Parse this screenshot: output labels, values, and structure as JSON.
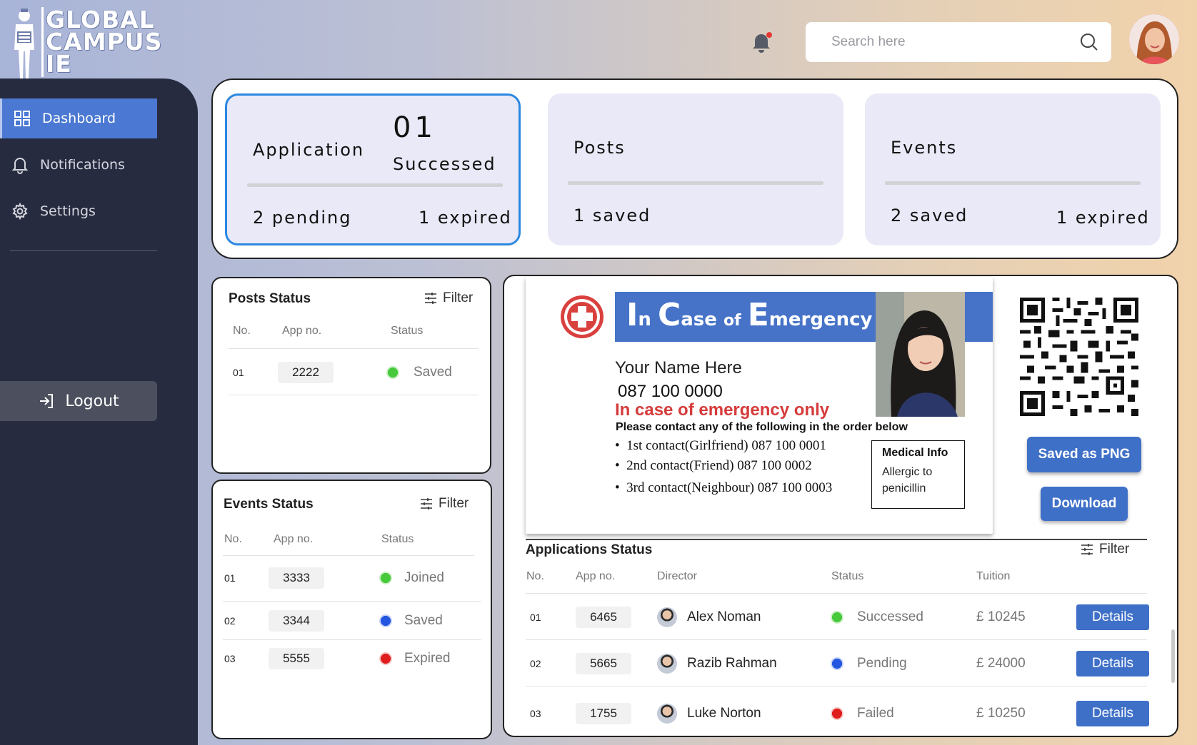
{
  "brand": {
    "logo_lines": [
      "GLOBAL",
      "CAMPUS",
      "IE"
    ]
  },
  "sidebar": {
    "items": [
      {
        "label": "Dashboard",
        "icon": "grid-icon",
        "active": true
      },
      {
        "label": "Notifications",
        "icon": "bell-icon",
        "active": false
      },
      {
        "label": "Settings",
        "icon": "gear-icon",
        "active": false
      }
    ],
    "logout_label": "Logout"
  },
  "header": {
    "search_placeholder": "Search here",
    "notification_badge": true
  },
  "summary": {
    "application": {
      "label": "Application",
      "count": "01",
      "count_label": "Successed",
      "left_note": "2 pending",
      "right_note": "1 expired"
    },
    "posts": {
      "label": "Posts",
      "left_note": "1 saved"
    },
    "events": {
      "label": "Events",
      "left_note": "2 saved",
      "right_note": "1 expired"
    }
  },
  "posts_status": {
    "title": "Posts Status",
    "filter_label": "Filter",
    "columns": [
      "No.",
      "App no.",
      "Status"
    ],
    "rows": [
      {
        "no": "01",
        "app_no": "2222",
        "status": "Saved",
        "status_color": "green"
      }
    ]
  },
  "events_status": {
    "title": "Events Status",
    "filter_label": "Filter",
    "columns": [
      "No.",
      "App no.",
      "Status"
    ],
    "rows": [
      {
        "no": "01",
        "app_no": "3333",
        "status": "Joined",
        "status_color": "green"
      },
      {
        "no": "02",
        "app_no": "3344",
        "status": "Saved",
        "status_color": "blue"
      },
      {
        "no": "03",
        "app_no": "5555",
        "status": "Expired",
        "status_color": "red"
      }
    ]
  },
  "ice_card": {
    "title_parts": [
      "I",
      "n",
      "C",
      "ase",
      "of",
      "E",
      "mergency"
    ],
    "name": "Your Name Here",
    "phone": "087 100 0000",
    "warning": "In case of emergency only",
    "instruction": "Please contact any of the following in the order below",
    "contacts": [
      "1st contact(Girlfriend) 087 100 0001",
      "2nd contact(Friend) 087 100 0002",
      "3rd contact(Neighbour) 087 100 0003"
    ],
    "medical_title": "Medical Info",
    "medical_body_lines": [
      "Allergic to",
      "penicillin"
    ]
  },
  "actions": {
    "save_png_label": "Saved as PNG",
    "download_label": "Download"
  },
  "applications_status": {
    "title": "Applications Status",
    "filter_label": "Filter",
    "columns": [
      "No.",
      "App no.",
      "Director",
      "Status",
      "Tuition"
    ],
    "rows": [
      {
        "no": "01",
        "app_no": "6465",
        "director": "Alex Noman",
        "status": "Successed",
        "status_color": "green",
        "tuition": "£ 10245",
        "action": "Details"
      },
      {
        "no": "02",
        "app_no": "5665",
        "director": "Razib Rahman",
        "status": "Pending",
        "status_color": "blue",
        "tuition": "£ 24000",
        "action": "Details"
      },
      {
        "no": "03",
        "app_no": "1755",
        "director": "Luke Norton",
        "status": "Failed",
        "status_color": "red",
        "tuition": "£ 10250",
        "action": "Details"
      }
    ]
  },
  "colors": {
    "accent": "#4a78d2",
    "sidebar_bg": "#272b3f",
    "active_card_border": "#2b88e0",
    "warning_red": "#d63b3b"
  }
}
